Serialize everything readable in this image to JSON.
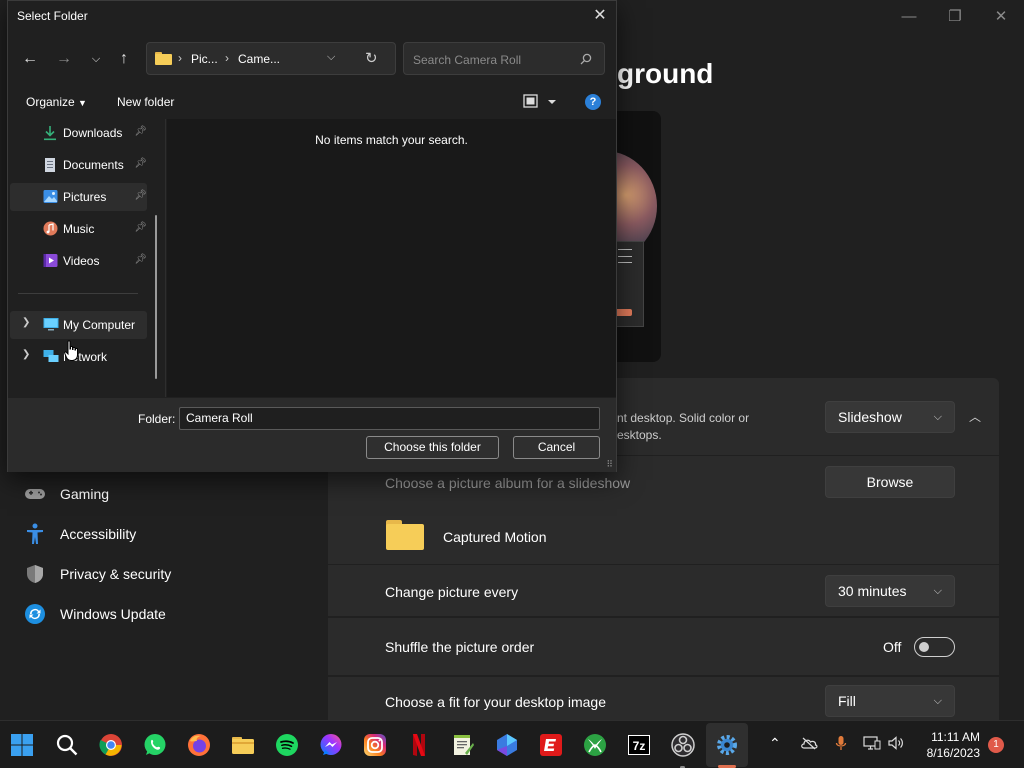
{
  "dialog": {
    "title": "Select Folder",
    "address_crumbs": [
      "Pic...",
      "Came..."
    ],
    "search_placeholder": "Search Camera Roll",
    "organize_label": "Organize",
    "new_folder_label": "New folder",
    "help_label": "?",
    "empty_message": "No items match your search.",
    "tree": [
      {
        "label": "Downloads",
        "pinned": true
      },
      {
        "label": "Documents",
        "pinned": true
      },
      {
        "label": "Pictures",
        "pinned": true,
        "selected": true
      },
      {
        "label": "Music",
        "pinned": true
      },
      {
        "label": "Videos",
        "pinned": true
      },
      {
        "label": "My Computer",
        "expandable": true,
        "hovered": true
      },
      {
        "label": "Network",
        "expandable": true
      }
    ],
    "folder_label": "Folder:",
    "folder_value": "Camera Roll",
    "choose_button": "Choose this folder",
    "cancel_button": "Cancel"
  },
  "settings": {
    "heading_fragment": "ground",
    "background_desc_line1": "nt desktop. Solid color or",
    "background_desc_line2": "esktops.",
    "background_value": "Slideshow",
    "album_label": "Choose a picture album for a slideshow",
    "browse_label": "Browse",
    "album_folder": "Captured Motion",
    "change_label": "Change picture every",
    "change_value": "30 minutes",
    "shuffle_label": "Shuffle the picture order",
    "shuffle_state": "Off",
    "fit_label": "Choose a fit for your desktop image",
    "fit_value": "Fill",
    "nav": [
      "Gaming",
      "Accessibility",
      "Privacy & security",
      "Windows Update"
    ]
  },
  "taskbar": {
    "time": "11:11 AM",
    "date": "8/16/2023",
    "notifications": "1",
    "apps": [
      "Start",
      "Search",
      "Chrome",
      "WhatsApp",
      "Firefox",
      "File Explorer",
      "Spotify",
      "Messenger",
      "Instagram",
      "Netflix",
      "Notepad++",
      "Copilot",
      "ESPN",
      "Xbox",
      "7-Zip",
      "OBS Studio",
      "Settings"
    ]
  },
  "colors": {
    "accent": "#2b80d8",
    "folder_yellow": "#f6cd58",
    "notification": "#e05a4a"
  }
}
